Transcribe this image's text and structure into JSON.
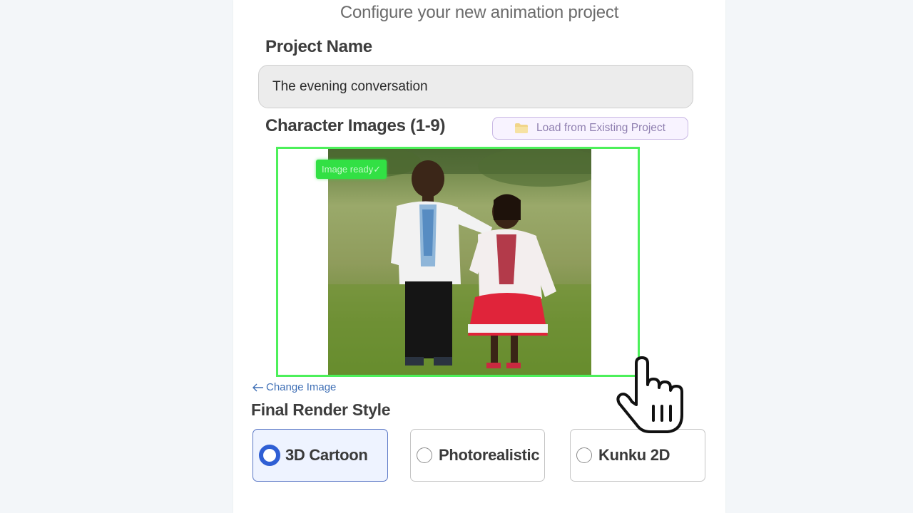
{
  "subtitle": "Configure your new animation project",
  "project_name": {
    "label": "Project Name",
    "value": "The evening conversation"
  },
  "character_images": {
    "label": "Character Images (1-9)",
    "load_button": "Load from Existing Project",
    "status_badge": "Image ready✓",
    "change_link": "Change Image",
    "frame_color": "#4cf05a"
  },
  "render_style": {
    "label": "Final Render Style",
    "options": [
      {
        "label": "3D Cartoon",
        "selected": true
      },
      {
        "label": "Photorealistic",
        "selected": false
      },
      {
        "label": "Kunku 2D",
        "selected": false
      }
    ]
  },
  "colors": {
    "accent": "#2f5fd4",
    "ready_green": "#32e044",
    "link": "#3f6fb5"
  },
  "icons": [
    "folder-icon",
    "arrow-left-icon",
    "radio-icon",
    "pointer-hand-icon"
  ]
}
